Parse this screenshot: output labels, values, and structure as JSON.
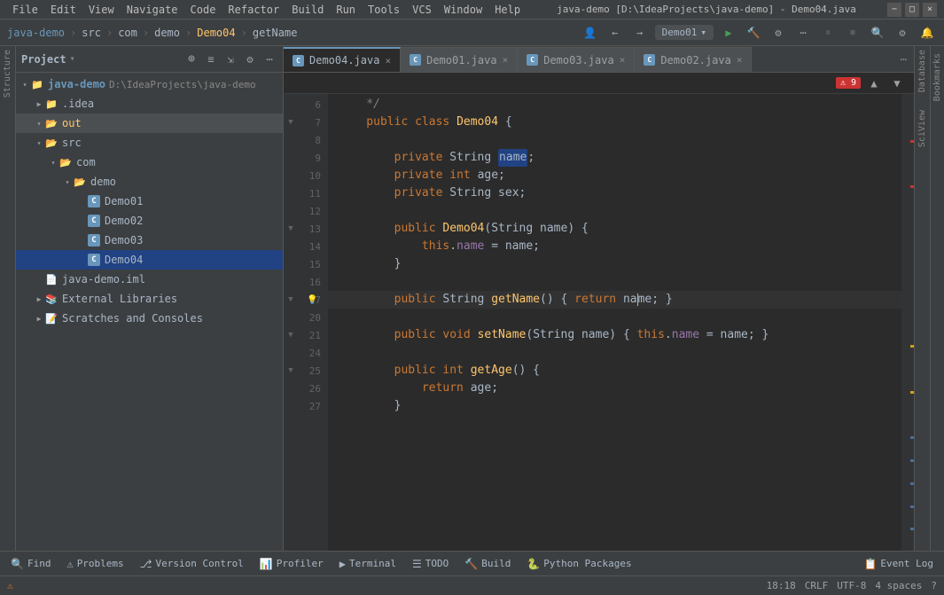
{
  "titleBar": {
    "title": "java-demo [D:\\IdeaProjects\\java-demo] - Demo04.java",
    "menus": [
      "File",
      "Edit",
      "View",
      "Navigate",
      "Code",
      "Refactor",
      "Build",
      "Run",
      "Tools",
      "VCS",
      "Window",
      "Help"
    ],
    "projectName": "java-demo",
    "windowControls": [
      "−",
      "□",
      "×"
    ]
  },
  "navbar": {
    "breadcrumb": [
      "java-demo",
      "src",
      "com",
      "demo",
      "Demo04",
      "getName"
    ],
    "runConfig": "Demo01",
    "icons": [
      "back",
      "forward",
      "search",
      "settings",
      "notifications"
    ]
  },
  "sidebar": {
    "title": "Project",
    "tree": [
      {
        "id": "java-demo-root",
        "label": "java-demo",
        "sublabel": "D:\\IdeaProjects\\java-demo",
        "type": "project",
        "expanded": true,
        "level": 0
      },
      {
        "id": "idea-folder",
        "label": ".idea",
        "type": "folder",
        "expanded": false,
        "level": 1
      },
      {
        "id": "out-folder",
        "label": "out",
        "type": "folder-open",
        "expanded": true,
        "level": 1,
        "selected": false
      },
      {
        "id": "src-folder",
        "label": "src",
        "type": "folder-open",
        "expanded": true,
        "level": 1
      },
      {
        "id": "com-folder",
        "label": "com",
        "type": "folder-open",
        "expanded": true,
        "level": 2
      },
      {
        "id": "demo-folder",
        "label": "demo",
        "type": "folder-open",
        "expanded": true,
        "level": 3
      },
      {
        "id": "Demo01",
        "label": "Demo01",
        "type": "java",
        "level": 4
      },
      {
        "id": "Demo02",
        "label": "Demo02",
        "type": "java",
        "level": 4
      },
      {
        "id": "Demo03",
        "label": "Demo03",
        "type": "java",
        "level": 4
      },
      {
        "id": "Demo04",
        "label": "Demo04",
        "type": "java",
        "level": 4,
        "selected": true
      },
      {
        "id": "java-demo-iml",
        "label": "java-demo.iml",
        "type": "iml",
        "level": 1
      },
      {
        "id": "external-libs",
        "label": "External Libraries",
        "type": "external",
        "level": 1
      },
      {
        "id": "scratches",
        "label": "Scratches and Consoles",
        "type": "scratches",
        "level": 1
      }
    ]
  },
  "tabs": [
    {
      "label": "Demo04.java",
      "active": true
    },
    {
      "label": "Demo01.java",
      "active": false
    },
    {
      "label": "Demo03.java",
      "active": false
    },
    {
      "label": "Demo02.java",
      "active": false
    }
  ],
  "editor": {
    "errorCount": 9,
    "lines": [
      {
        "num": 6,
        "code": "    */",
        "type": "comment"
      },
      {
        "num": 7,
        "code": "    public class Demo04 {",
        "type": "code"
      },
      {
        "num": 8,
        "code": "",
        "type": "empty"
      },
      {
        "num": 9,
        "code": "        private String name;",
        "type": "code"
      },
      {
        "num": 10,
        "code": "        private int age;",
        "type": "code"
      },
      {
        "num": 11,
        "code": "        private String sex;",
        "type": "code"
      },
      {
        "num": 12,
        "code": "",
        "type": "empty"
      },
      {
        "num": 13,
        "code": "        public Demo04(String name) {",
        "type": "code",
        "hasFold": true
      },
      {
        "num": 14,
        "code": "            this.name = name;",
        "type": "code"
      },
      {
        "num": 15,
        "code": "        }",
        "type": "code"
      },
      {
        "num": 16,
        "code": "",
        "type": "empty"
      },
      {
        "num": 17,
        "code": "        public String getName() { return name; }",
        "type": "code",
        "hasIcon": "bulb"
      },
      {
        "num": 20,
        "code": "",
        "type": "empty"
      },
      {
        "num": 21,
        "code": "        public void setName(String name) { this.name = name; }",
        "type": "code",
        "hasFold": true
      },
      {
        "num": 24,
        "code": "",
        "type": "empty"
      },
      {
        "num": 25,
        "code": "        public int getAge() {",
        "type": "code",
        "hasFold": true
      },
      {
        "num": 26,
        "code": "            return age;",
        "type": "code"
      },
      {
        "num": 27,
        "code": "        }",
        "type": "code"
      }
    ]
  },
  "bottomToolbar": {
    "buttons": [
      {
        "label": "Find",
        "icon": "🔍"
      },
      {
        "label": "Problems",
        "icon": "⚠"
      },
      {
        "label": "Version Control",
        "icon": "⎇"
      },
      {
        "label": "Profiler",
        "icon": "📊"
      },
      {
        "label": "Terminal",
        "icon": "▶"
      },
      {
        "label": "TODO",
        "icon": "☰"
      },
      {
        "label": "Build",
        "icon": "🔨"
      },
      {
        "label": "Python Packages",
        "icon": "🐍"
      },
      {
        "label": "Event Log",
        "icon": "📋"
      }
    ]
  },
  "statusBar": {
    "position": "18:18",
    "lineEnding": "CRLF",
    "encoding": "UTF-8",
    "indent": "4 spaces",
    "warning": "⚠"
  },
  "verticalPanels": {
    "left": [
      "Structure"
    ],
    "right": [
      "Database",
      "SciView"
    ]
  }
}
